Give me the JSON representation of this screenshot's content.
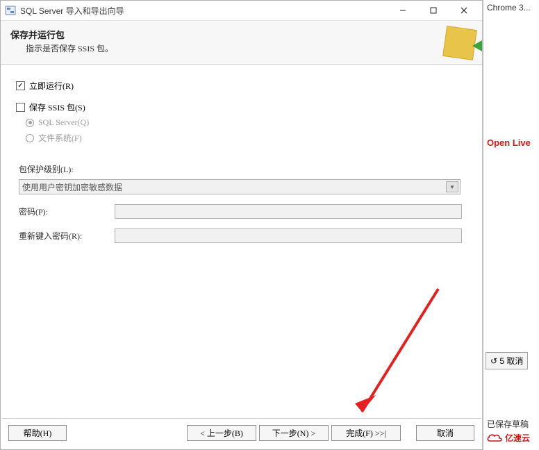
{
  "titlebar": {
    "title": "SQL Server 导入和导出向导"
  },
  "header": {
    "title": "保存并运行包",
    "subtitle": "指示是否保存 SSIS 包。"
  },
  "options": {
    "run_now": {
      "label": "立即运行(R)",
      "checked": true
    },
    "save_ssis": {
      "label": "保存 SSIS 包(S)",
      "checked": false
    },
    "target_sql": {
      "label": "SQL Server(Q)",
      "selected": true
    },
    "target_fs": {
      "label": "文件系统(F)",
      "selected": false
    }
  },
  "protection": {
    "label": "包保护级别(L):",
    "value": "使用用户密钥加密敏感数据"
  },
  "password": {
    "label": "密码(P):",
    "value": ""
  },
  "password_confirm": {
    "label": "重新键入密码(R):",
    "value": ""
  },
  "buttons": {
    "help": "帮助(H)",
    "back": "< 上一步(B)",
    "next": "下一步(N) >",
    "finish": "完成(F) >>|",
    "cancel": "取消"
  },
  "sidebar": {
    "chrome_tab": "Chrome 3...",
    "open_live": "Open Live",
    "undo": "↺ 5 取消",
    "saved_draft": "已保存草稿",
    "brand": "亿速云"
  }
}
